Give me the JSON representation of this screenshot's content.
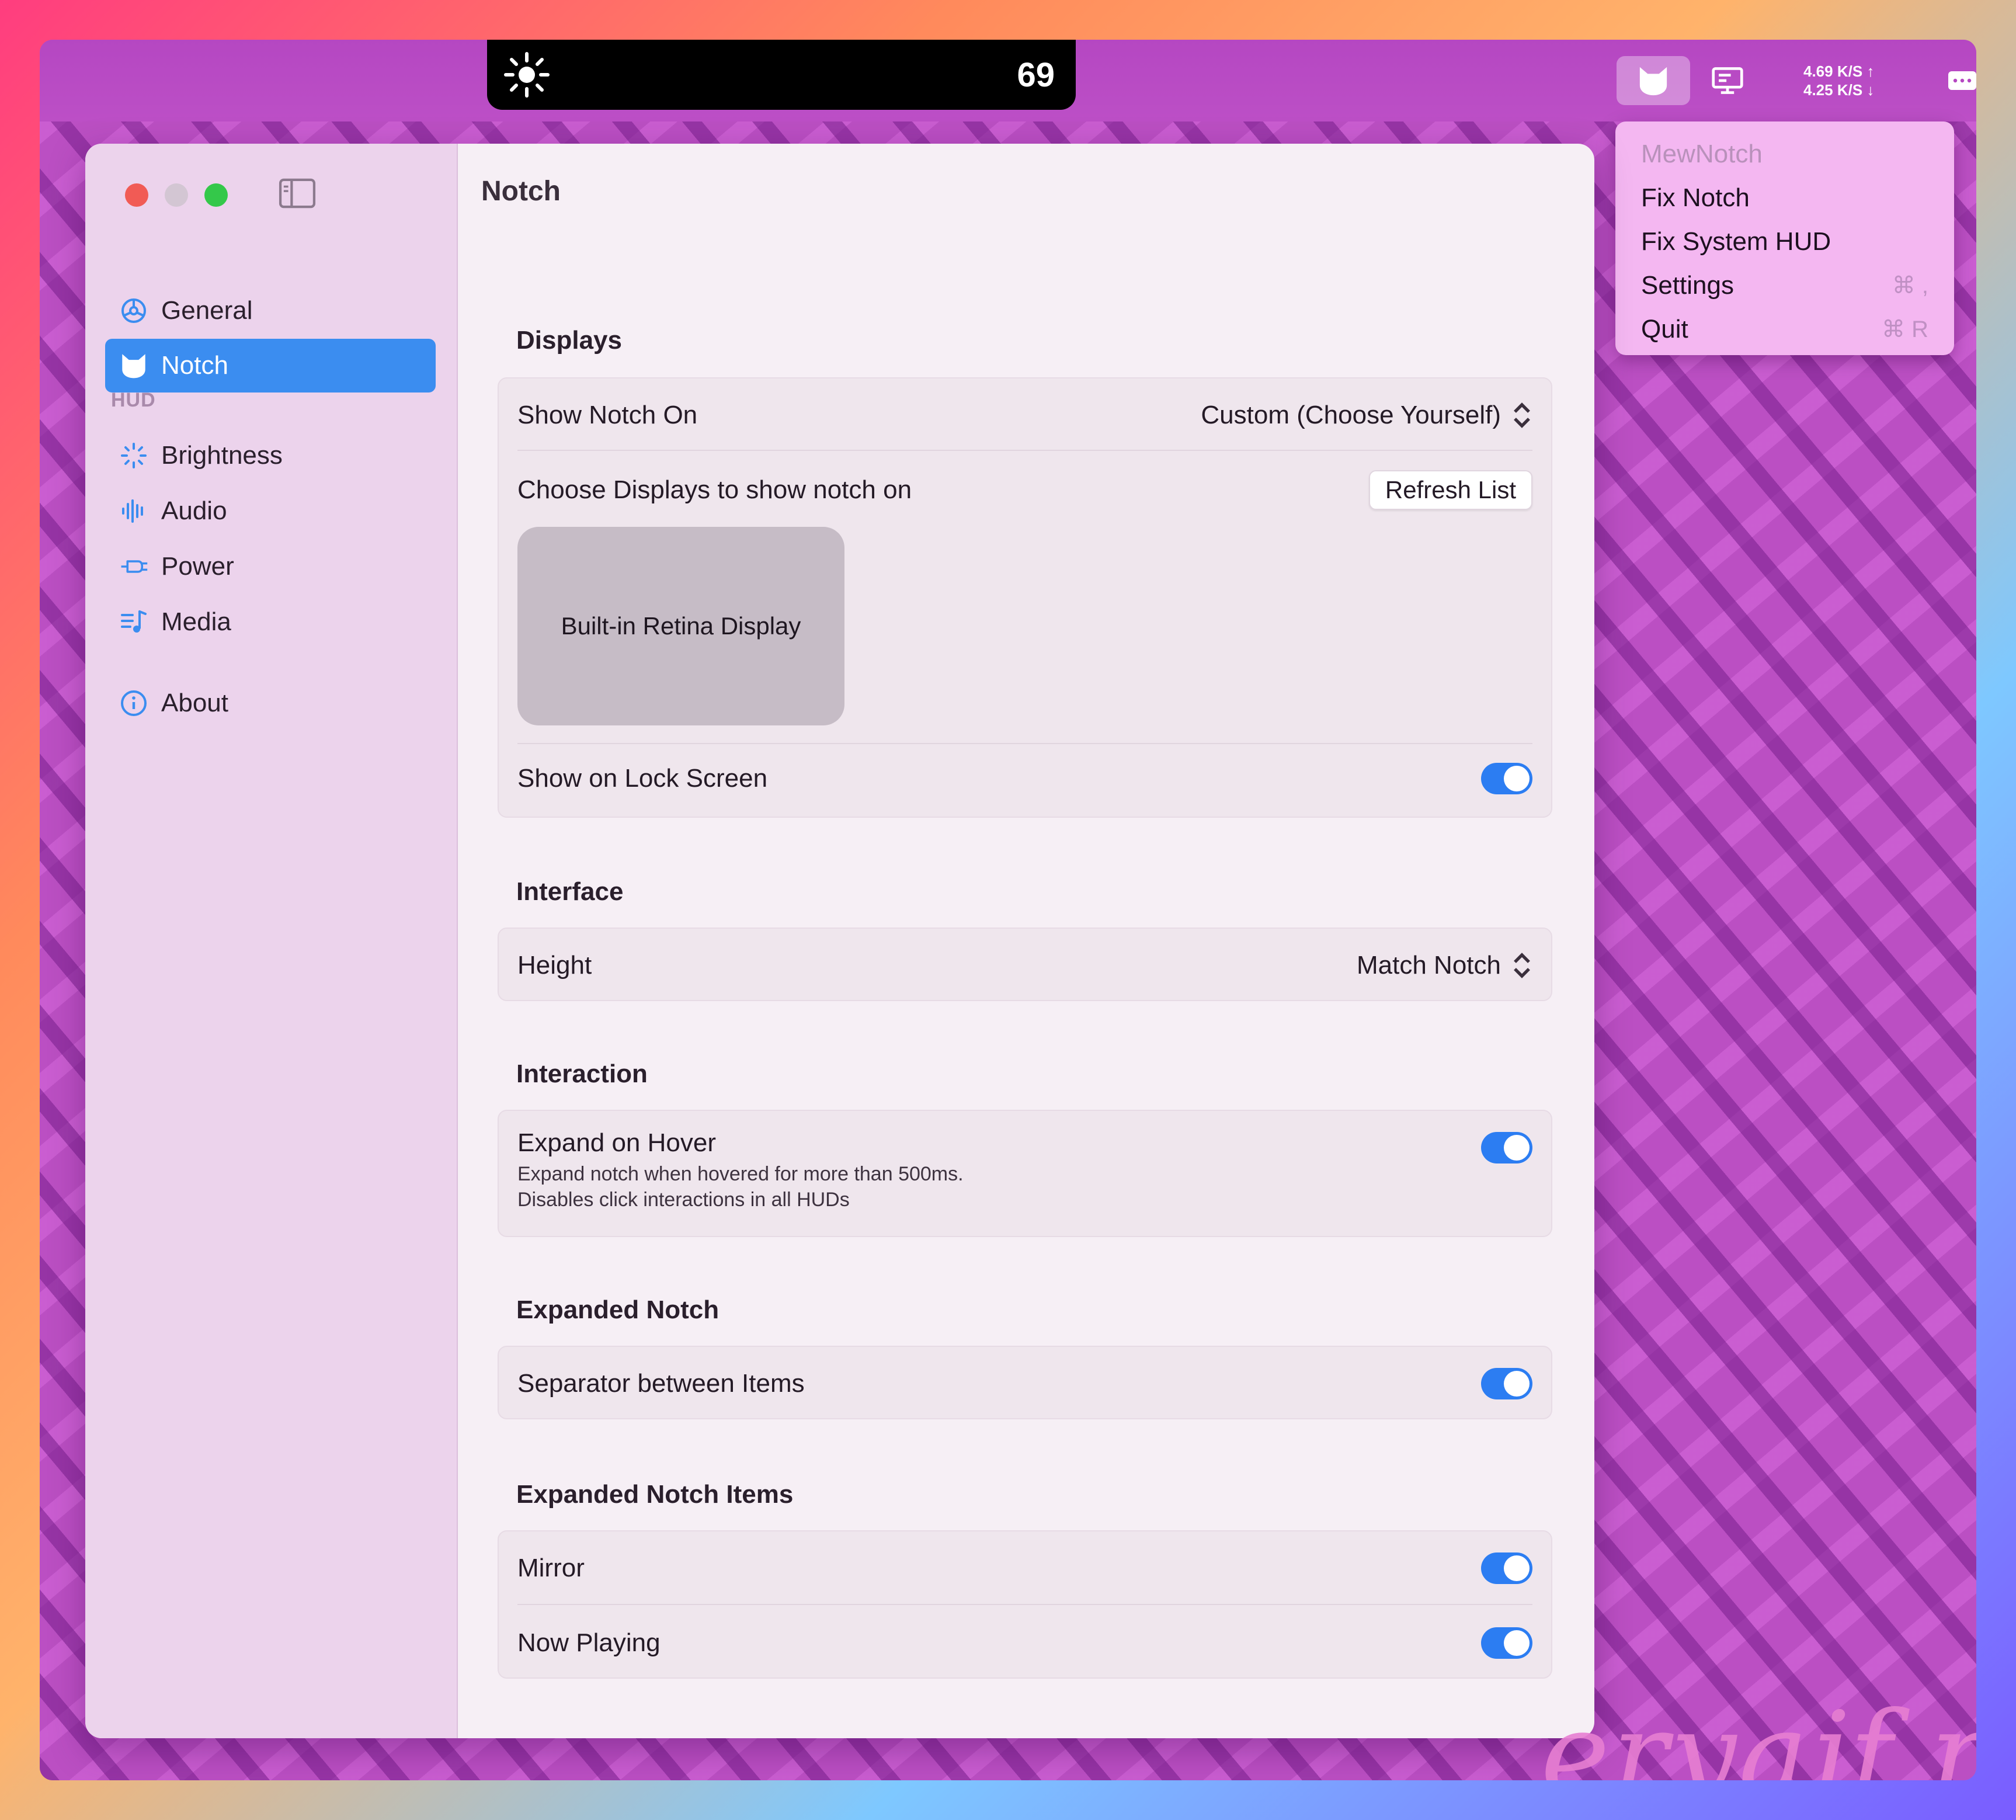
{
  "menubar": {
    "notch_value": "69",
    "net_up": "4.69 K/S ↑",
    "net_down": "4.25 K/S ↓"
  },
  "menu": {
    "app_name": "MewNotch",
    "items": [
      {
        "label": "Fix Notch",
        "shortcut": ""
      },
      {
        "label": "Fix System HUD",
        "shortcut": ""
      },
      {
        "label": "Settings",
        "shortcut": "⌘ ,"
      },
      {
        "label": "Quit",
        "shortcut": "⌘ R"
      }
    ]
  },
  "sidebar": {
    "general": "General",
    "notch": "Notch",
    "hud_section": "HUD",
    "brightness": "Brightness",
    "audio": "Audio",
    "power": "Power",
    "media": "Media",
    "about": "About"
  },
  "content": {
    "title": "Notch",
    "displays": {
      "heading": "Displays",
      "show_notch_on_label": "Show Notch On",
      "show_notch_on_value": "Custom (Choose Yourself)",
      "choose_label": "Choose Displays to show notch on",
      "refresh_button": "Refresh List",
      "display_tile": "Built-in Retina Display",
      "lock_screen_label": "Show on Lock Screen",
      "lock_screen_on": true
    },
    "interface": {
      "heading": "Interface",
      "height_label": "Height",
      "height_value": "Match Notch"
    },
    "interaction": {
      "heading": "Interaction",
      "expand_hover_label": "Expand on Hover",
      "expand_hover_desc1": "Expand notch when hovered for more than 500ms.",
      "expand_hover_desc2": "Disables click interactions in all HUDs",
      "expand_hover_on": true
    },
    "expanded_notch": {
      "heading": "Expanded Notch",
      "separator_label": "Separator between Items",
      "separator_on": true
    },
    "expanded_items": {
      "heading": "Expanded Notch Items",
      "mirror_label": "Mirror",
      "mirror_on": true,
      "now_playing_label": "Now Playing",
      "now_playing_on": true
    }
  },
  "watermark": "eryajf.net",
  "colors": {
    "accent": "#2c7df2",
    "sidebar_active": "#3b8df0",
    "menu_bg": "#f4b7f1",
    "wallpaper": "#bb4fc3"
  }
}
